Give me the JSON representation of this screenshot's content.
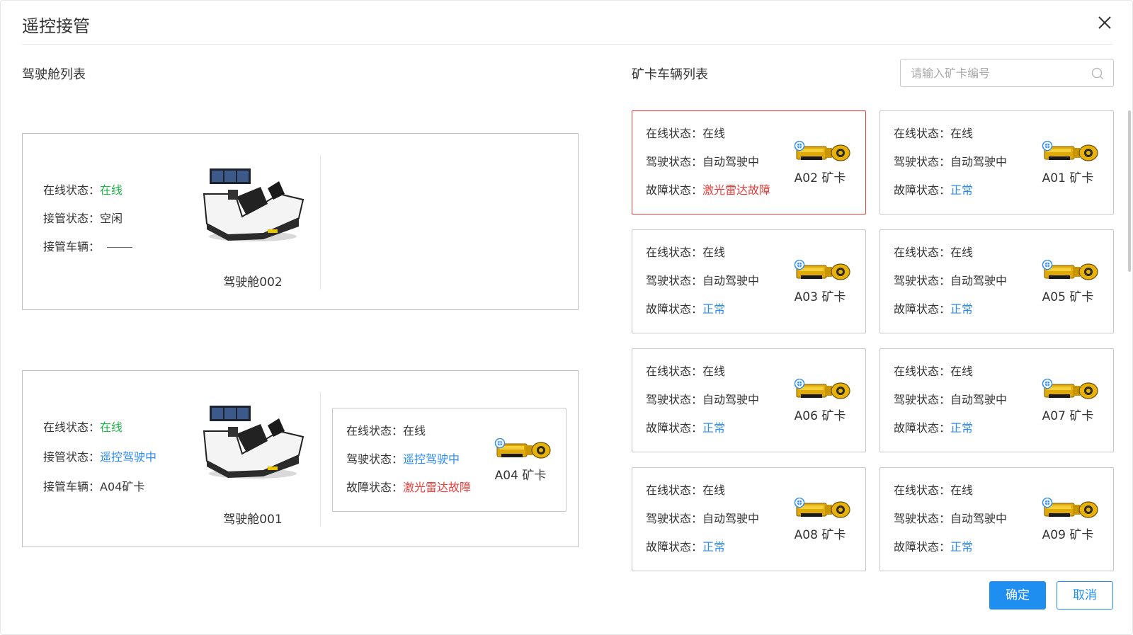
{
  "dialog": {
    "title": "遥控接管",
    "confirm_label": "确定",
    "cancel_label": "取消"
  },
  "cockpit_section": {
    "title": "驾驶舱列表",
    "cockpits": [
      {
        "name": "驾驶舱002",
        "online_label": "在线状态：",
        "online_value": "在线",
        "takeover_label": "接管状态：",
        "takeover_value": "空闲",
        "vehicle_label": "接管车辆：",
        "vehicle_value": ""
      },
      {
        "name": "驾驶舱001",
        "online_label": "在线状态：",
        "online_value": "在线",
        "takeover_label": "接管状态：",
        "takeover_value": "遥控驾驶中",
        "vehicle_label": "接管车辆：",
        "vehicle_value": "A04矿卡",
        "linked_truck": {
          "label": "A04 矿卡",
          "online_label": "在线状态：",
          "online_value": "在线",
          "drive_label": "驾驶状态：",
          "drive_value": "遥控驾驶中",
          "fault_label": "故障状态：",
          "fault_value": "激光雷达故障"
        }
      }
    ]
  },
  "truck_section": {
    "title": "矿卡车辆列表",
    "search_placeholder": "请输入矿卡编号",
    "trucks": [
      {
        "label": "A02 矿卡",
        "online_label": "在线状态：",
        "online_value": "在线",
        "drive_label": "驾驶状态：",
        "drive_value": "自动驾驶中",
        "fault_label": "故障状态：",
        "fault_value": "激光雷达故障"
      },
      {
        "label": "A01 矿卡",
        "online_label": "在线状态：",
        "online_value": "在线",
        "drive_label": "驾驶状态：",
        "drive_value": "自动驾驶中",
        "fault_label": "故障状态：",
        "fault_value": "正常"
      },
      {
        "label": "A03 矿卡",
        "online_label": "在线状态：",
        "online_value": "在线",
        "drive_label": "驾驶状态：",
        "drive_value": "自动驾驶中",
        "fault_label": "故障状态：",
        "fault_value": "正常"
      },
      {
        "label": "A05 矿卡",
        "online_label": "在线状态：",
        "online_value": "在线",
        "drive_label": "驾驶状态：",
        "drive_value": "自动驾驶中",
        "fault_label": "故障状态：",
        "fault_value": "正常"
      },
      {
        "label": "A06 矿卡",
        "online_label": "在线状态：",
        "online_value": "在线",
        "drive_label": "驾驶状态：",
        "drive_value": "自动驾驶中",
        "fault_label": "故障状态：",
        "fault_value": "正常"
      },
      {
        "label": "A07 矿卡",
        "online_label": "在线状态：",
        "online_value": "在线",
        "drive_label": "驾驶状态：",
        "drive_value": "自动驾驶中",
        "fault_label": "故障状态：",
        "fault_value": "正常"
      },
      {
        "label": "A08 矿卡",
        "online_label": "在线状态：",
        "online_value": "在线",
        "drive_label": "驾驶状态：",
        "drive_value": "自动驾驶中",
        "fault_label": "故障状态：",
        "fault_value": "正常"
      },
      {
        "label": "A09 矿卡",
        "online_label": "在线状态：",
        "online_value": "在线",
        "drive_label": "驾驶状态：",
        "drive_value": "自动驾驶中",
        "fault_label": "故障状态：",
        "fault_value": "正常"
      }
    ]
  },
  "colors": {
    "accent": "#1e8ff0",
    "online": "#1fb34a",
    "fault": "#e8403c",
    "truck_body": "#e8b20c"
  },
  "icons": {
    "close": "close-icon",
    "search": "search-icon",
    "truck": "mining-truck-icon",
    "cockpit": "cockpit-simulator-image"
  }
}
